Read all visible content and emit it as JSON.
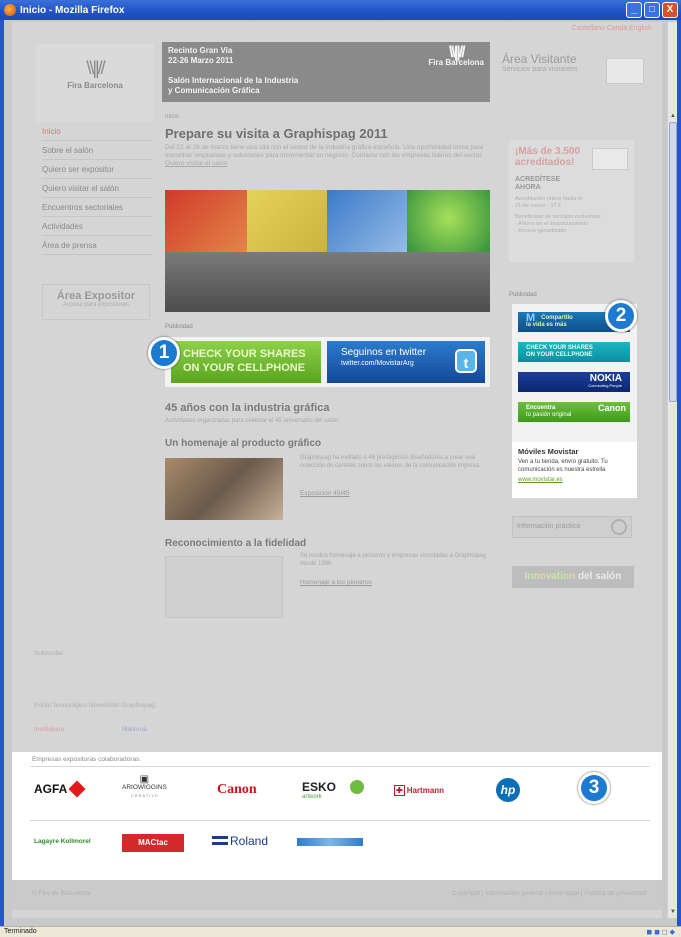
{
  "window": {
    "title": "Inicio - Mozilla Firefox",
    "controls": [
      "_",
      "□",
      "X"
    ]
  },
  "top_links": "Castellano  Català  English",
  "header": {
    "logo_name": "Fira Barcelona",
    "banner": {
      "line1": "Recinto Gran Via",
      "line2": "22-26 Marzo 2011",
      "line3": "Salón Internacional de la Industria",
      "line4": "y Comunicación Gráfica",
      "logo": "Fira Barcelona"
    },
    "area_visitante": {
      "title": "Área Visitante",
      "subtitle": "Servicios para visitantes"
    }
  },
  "nav": {
    "items": [
      {
        "label": "Inicio",
        "active": true
      },
      {
        "label": "Sobre el salón"
      },
      {
        "label": "Quiero ser expositor"
      },
      {
        "label": "Quiero visitar el salón"
      },
      {
        "label": "Encuentros sectoriales"
      },
      {
        "label": "Actividades"
      },
      {
        "label": "Área de prensa"
      }
    ],
    "area_expositor": {
      "title": "Área Expositor",
      "subtitle": "Acceso para expositores"
    }
  },
  "main": {
    "breadcrumb": "Inicio",
    "title": "Prepare su visita a Graphispag 2011",
    "intro": "Del 22 al 26 de marzo tiene una cita con el sector de la industria gráfica española. Una oportunidad única para encontrar respuestas y soluciones para incrementar su negocio. Contacte con las empresas líderes del sector.",
    "intro_link": "Quiero visitar el salón",
    "publicidad": "Publicidad",
    "ad_green": {
      "line1": "CHECK YOUR SHARES",
      "line2": "ON YOUR CELLPHONE"
    },
    "ad_twitter": {
      "line1": "Seguinos en twitter",
      "line2": "twitter.com/MovistarArg",
      "icon": "t"
    },
    "sec1": {
      "title": "45 años con la industria gráfica",
      "sub": "Actividades organizadas para celebrar el 45 aniversario del salón."
    },
    "sec2": {
      "title": "Un homenaje al producto gráfico",
      "text": "Graphispag ha invitado a 46 prestigiosos diseñadores a crear una colección de carteles sobre los valores de la comunicación impresa.",
      "link": "Exposición 45/45"
    },
    "sec3": {
      "title": "Reconocimiento a la fidelidad",
      "text": "Se rendirá homenaje a pioneros y empresas vinculadas a Graphispag desde 1966.",
      "link": "Homenaje a los pioneros"
    },
    "subscribe": "Subscribe",
    "footer_links": "Portal Tecnológico     Newsletter Graphispag",
    "logos_small": [
      "medialuna",
      "Mallorca"
    ]
  },
  "right": {
    "acred": {
      "big1": "¡Más de 3.500",
      "big2": "acreditados!",
      "mid1": "ACREDÍTESE",
      "mid2": "AHORA",
      "small1": "Acreditación online hasta el",
      "small2": "21 de marzo - 17 €",
      "small3": "Beneficiese de ventajas exclusivas:",
      "small4": "- Ahorro en el desplazamiento",
      "small5": "- Acceso garantizado"
    },
    "publicidad": "Publicidad",
    "ad1": {
      "line1": "Compartilo",
      "line2": "la vida es más"
    },
    "ad2": {
      "line1": "CHECK YOUR SHARES",
      "line2": "ON YOUR CELLPHONE"
    },
    "ad3": {
      "line1": "NOKIA",
      "line2": "Connecting People"
    },
    "ad4": {
      "line1": "Encuentra",
      "line2": "tu pasión original",
      "brand": "Canon"
    },
    "movistar": {
      "title": "Móviles Movistar",
      "desc": "Ven a tu tienda, envío gratuito. Tu comunicación es nuestra estrella",
      "link": "www.movistar.es"
    },
    "info": "Información práctica",
    "innovation": {
      "a": "Innovation",
      "b": "del salón"
    }
  },
  "collab": {
    "label": "Empresas expositoras colaboradoras:",
    "logos": {
      "agfa": "AGFA",
      "ario_line1": "ARIOWIGGINS",
      "ario_line2": "C R E A T I V E",
      "canon": "Canon",
      "esko": "ESKO",
      "esko_sub": "artwork",
      "hartmann": "Hartmann",
      "hp": "hp",
      "lugaro": "Lagayre Kollmorel",
      "mactac": "MACtac",
      "roland": "Roland"
    }
  },
  "page_footer": {
    "left": "© Fira de Barcelona",
    "right": "Copyright  |  Información general  |  Aviso legal  |  Política de privacidad"
  },
  "status": {
    "text": "Terminado"
  },
  "callouts": [
    "1",
    "2",
    "3"
  ]
}
